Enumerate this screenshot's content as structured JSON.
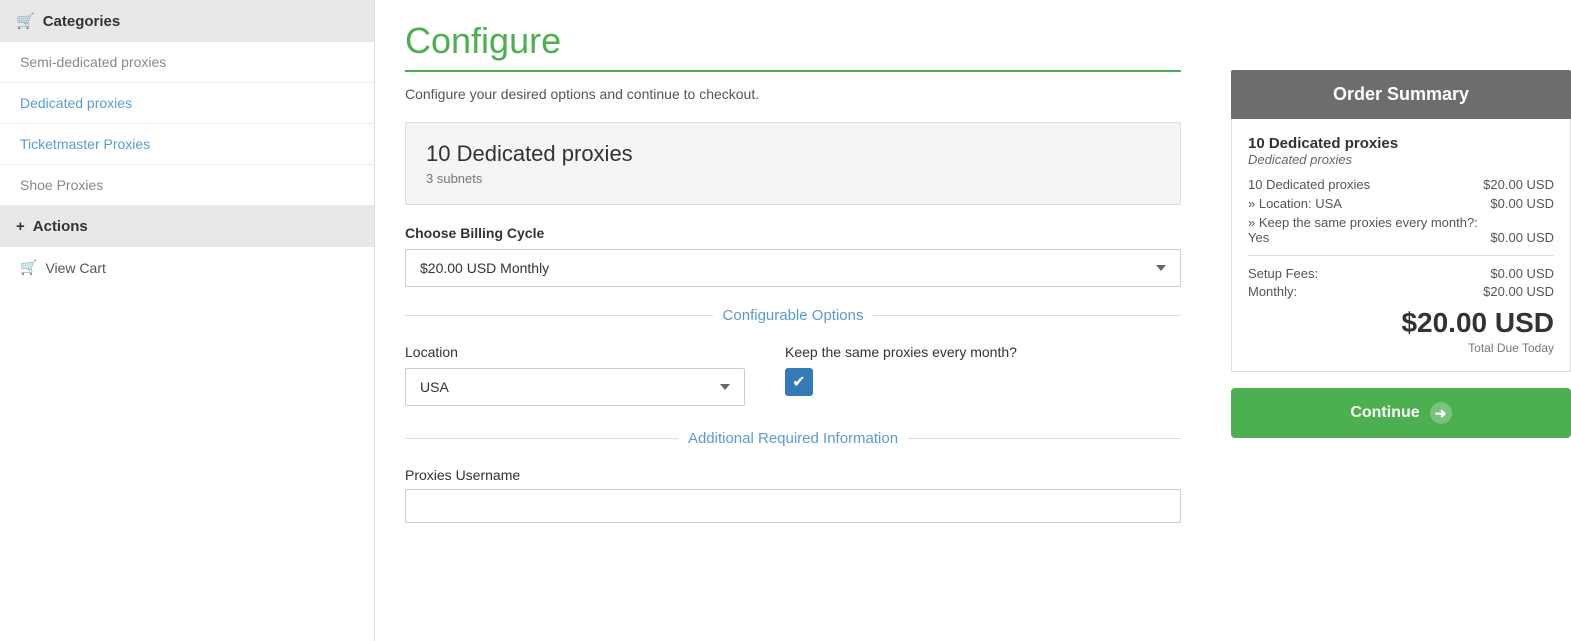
{
  "sidebar": {
    "categories_header": "Categories",
    "items": [
      {
        "label": "Semi-dedicated proxies",
        "style": "gray"
      },
      {
        "label": "Dedicated proxies",
        "style": "link"
      },
      {
        "label": "Ticketmaster Proxies",
        "style": "link"
      },
      {
        "label": "Shoe Proxies",
        "style": "gray"
      }
    ],
    "actions_header": "Actions",
    "view_cart": "View Cart"
  },
  "main": {
    "title": "Configure",
    "subtitle": "Configure your desired options and continue to checkout.",
    "product": {
      "name": "10 Dedicated proxies",
      "sub": "3 subnets"
    },
    "billing_label": "Choose Billing Cycle",
    "billing_options": [
      "$20.00 USD Monthly"
    ],
    "billing_selected": "$20.00 USD Monthly",
    "configurable_options_label": "Configurable Options",
    "location_label": "Location",
    "location_options": [
      "USA"
    ],
    "location_selected": "USA",
    "keep_same_label": "Keep the same proxies every month?",
    "keep_same_checked": true,
    "additional_info_label": "Additional Required Information",
    "proxies_username_label": "Proxies Username"
  },
  "order_summary": {
    "header": "Order Summary",
    "product_name": "10 Dedicated proxies",
    "product_sub": "Dedicated proxies",
    "line1_label": "10 Dedicated proxies",
    "line1_value": "$20.00 USD",
    "line2_label": "» Location: USA",
    "line2_value": "$0.00 USD",
    "line3_label": "» Keep the same proxies every month?:",
    "line3_value": "Yes",
    "line3_price": "$0.00 USD",
    "setup_label": "Setup Fees:",
    "setup_value": "$0.00 USD",
    "monthly_label": "Monthly:",
    "monthly_value": "$20.00 USD",
    "total": "$20.00 USD",
    "total_due_label": "Total Due Today",
    "continue_label": "Continue"
  },
  "icons": {
    "cart": "🛒",
    "plus": "+",
    "arrow_right": "→",
    "checkmark": "✔"
  }
}
